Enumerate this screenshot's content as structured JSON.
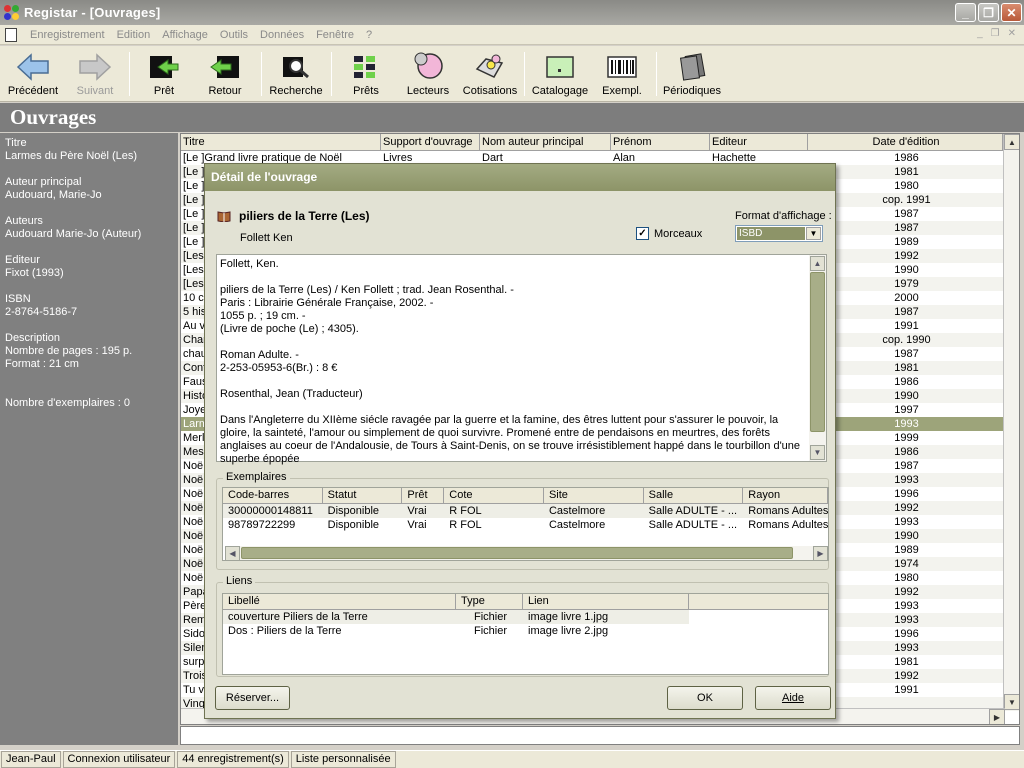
{
  "window": {
    "title": "Registar - [Ouvrages]"
  },
  "menu": {
    "items": [
      "Enregistrement",
      "Edition",
      "Affichage",
      "Outils",
      "Données",
      "Fenêtre",
      "?"
    ]
  },
  "toolbar": {
    "buttons": [
      {
        "label": "Précédent",
        "icon": "arrow-left-icon"
      },
      {
        "label": "Suivant",
        "icon": "arrow-right-icon",
        "disabled": true
      },
      {
        "label": "Prêt",
        "icon": "loan-icon"
      },
      {
        "label": "Retour",
        "icon": "return-icon"
      },
      {
        "label": "Recherche",
        "icon": "search-icon"
      },
      {
        "label": "Prêts",
        "icon": "loans-icon"
      },
      {
        "label": "Lecteurs",
        "icon": "readers-icon"
      },
      {
        "label": "Cotisations",
        "icon": "fees-icon"
      },
      {
        "label": "Catalogage",
        "icon": "catalog-icon"
      },
      {
        "label": "Exempl.",
        "icon": "barcode-icon"
      },
      {
        "label": "Périodiques",
        "icon": "periodicals-icon"
      }
    ]
  },
  "page": {
    "title": "Ouvrages"
  },
  "left_panel": {
    "title_label": "Titre",
    "title_value": "Larmes du Père Noël (Les)",
    "author_label": "Auteur principal",
    "author_value": "Audouard, Marie-Jo",
    "authors_label": "Auteurs",
    "authors_value": "Audouard Marie-Jo (Auteur)",
    "publisher_label": "Editeur",
    "publisher_value": "Fixot (1993)",
    "isbn_label": "ISBN",
    "isbn_value": "2-8764-5186-7",
    "description_label": "Description",
    "pages_value": "Nombre de pages : 195 p.",
    "format_value": "Format : 21 cm",
    "copies_value": "Nombre d'exemplaires : 0"
  },
  "grid": {
    "columns": [
      "Titre",
      "Support d'ouvrage",
      "Nom auteur principal",
      "Prénom",
      "Editeur",
      "Date d'édition"
    ],
    "first_row": {
      "titre": "[Le ]Grand livre pratique de Noël",
      "support": "Livres",
      "nom": "Dart",
      "prenom": "Alan",
      "editeur": "Hachette",
      "date": "1986"
    },
    "titles": [
      "[Le ]",
      "[Le ]",
      "[Le ]",
      "[Le ]",
      "[Le ]",
      "[Le ]",
      "[Les",
      "[Les",
      "[Les",
      "10 c",
      "5 his",
      "Au v",
      "Char",
      "chau",
      "Cont",
      "Faus",
      "Histo",
      "Joye",
      "Larm",
      "Merl",
      "Mes",
      "Noë",
      "Noë",
      "Noë",
      "Noë",
      "Noë",
      "Noë",
      "Noë",
      "Noë",
      "Noë",
      "Papa",
      "Père",
      "Rem",
      "Sido",
      "Siler",
      "surp",
      "Trois",
      "Tu v",
      "Ving"
    ],
    "dates": [
      "1981",
      "1980",
      "cop. 1991",
      "1987",
      "1987",
      "1989",
      "1992",
      "1990",
      "1979",
      "2000",
      "1987",
      "1991",
      "cop. 1990",
      "1987",
      "1981",
      "1986",
      "1990",
      "1997",
      "1993",
      "1999",
      "1986",
      "1987",
      "1993",
      "1996",
      "1992",
      "1993",
      "1990",
      "1989",
      "1974",
      "1980",
      "1992",
      "1993",
      "1993",
      "1996",
      "1993",
      "1981",
      "1992",
      "1991"
    ],
    "selected_index": 18
  },
  "status": {
    "user": "Jean-Paul",
    "connection": "Connexion utilisateur",
    "records": "44 enregistrement(s)",
    "list": "Liste personnalisée"
  },
  "dialog": {
    "title": "Détail de l'ouvrage",
    "book_title": "piliers de la Terre (Les)",
    "author": "Follett Ken",
    "morceaux_label": "Morceaux",
    "morceaux_checked": "✓",
    "format_label": "Format d'affichage :",
    "format_value": "ISBD",
    "isbd_lines": [
      "Follett, Ken.",
      "",
      "piliers de la Terre (Les) / Ken Follett ; trad. Jean Rosenthal. -",
      "Paris : Librairie Générale Française, 2002. -",
      "1055 p. ; 19 cm. -",
      "(Livre de poche (Le) ; 4305).",
      "",
      "Roman Adulte. -",
      "2-253-05953-6(Br.) : 8 €",
      "",
      "Rosenthal, Jean (Traducteur)",
      "",
      "Dans l'Angleterre du XIIème siécle ravagée par la guerre et la famine, des êtres luttent pour s'assurer le pouvoir, la gloire, la sainteté, l'amour ou simplement de quoi survivre. Promené entre de pendaisons en meurtres, des forêts anglaises au coeur de l'Andalousie, de Tours à Saint-Denis, on se trouve irrésistiblement happé dans le tourbillon d'une superbe épopée"
    ],
    "exemplaires": {
      "label": "Exemplaires",
      "columns": [
        "Code-barres",
        "Statut",
        "Prêt",
        "Cote",
        "Site",
        "Salle",
        "Rayon"
      ],
      "rows": [
        [
          "30000000148811",
          "Disponible",
          "Vrai",
          "R FOL",
          "Castelmore",
          "Salle ADULTE - ...",
          "Romans Adultes"
        ],
        [
          "98789722299",
          "Disponible",
          "Vrai",
          "R FOL",
          "Castelmore",
          "Salle ADULTE - ...",
          "Romans Adultes"
        ]
      ]
    },
    "liens": {
      "label": "Liens",
      "columns": [
        "Libellé",
        "Type",
        "Lien"
      ],
      "rows": [
        [
          "couverture Piliers de la Terre",
          "Fichier",
          "image livre 1.jpg"
        ],
        [
          "Dos : Piliers de la Terre",
          "Fichier",
          "image livre 2.jpg"
        ]
      ]
    },
    "reserve_button": "Réserver...",
    "ok_button": "OK",
    "help_button": "Aide"
  }
}
